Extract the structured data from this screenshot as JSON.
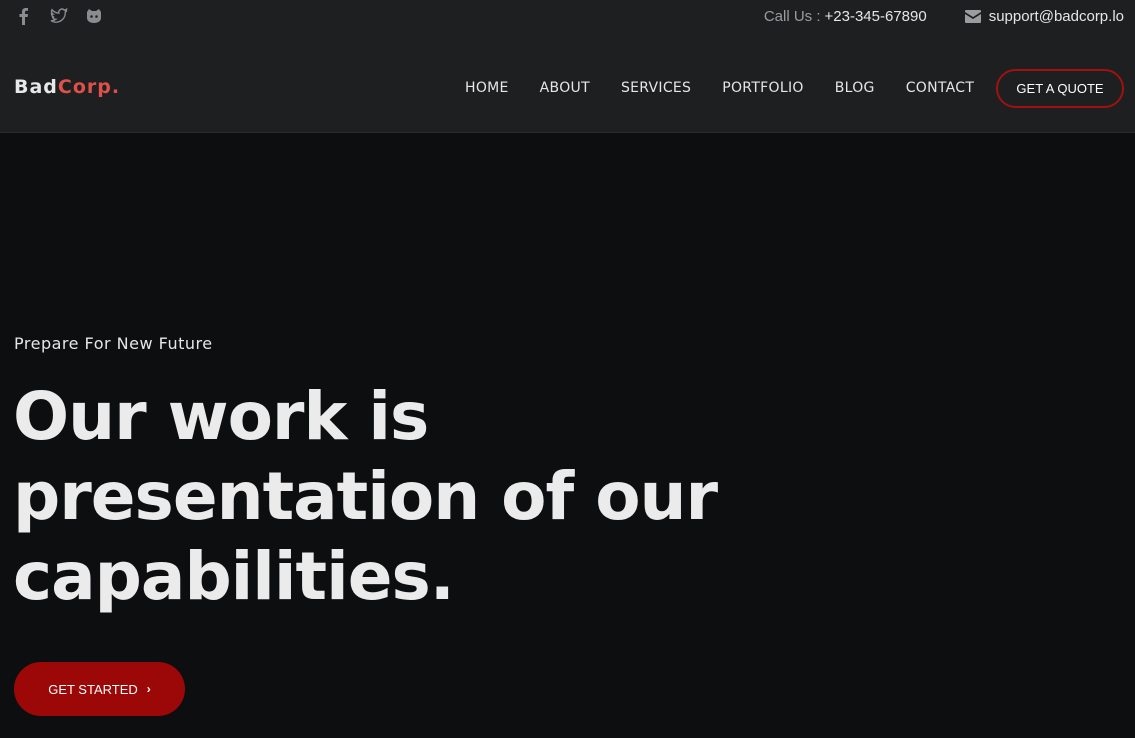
{
  "topbar": {
    "social": [
      "facebook-icon",
      "twitter-icon",
      "github-icon"
    ],
    "call_label": "Call Us :",
    "phone": "+23-345-67890",
    "email": "support@badcorp.lo"
  },
  "header": {
    "logo_main": "Bad",
    "logo_accent": "Corp.",
    "nav": [
      "HOME",
      "ABOUT",
      "SERVICES",
      "PORTFOLIO",
      "BLOG",
      "CONTACT"
    ],
    "quote_label": "GET A QUOTE"
  },
  "hero": {
    "subtitle": "Prepare For New Future",
    "title": "Our work is presentation of our capabilities.",
    "cta_label": "GET STARTED",
    "cta_icon": "chevron-right-icon"
  },
  "colors": {
    "accent": "#9c0808",
    "logo_accent": "#e0504a",
    "background": "#0d0e10",
    "header_bg": "#1e1f21"
  }
}
